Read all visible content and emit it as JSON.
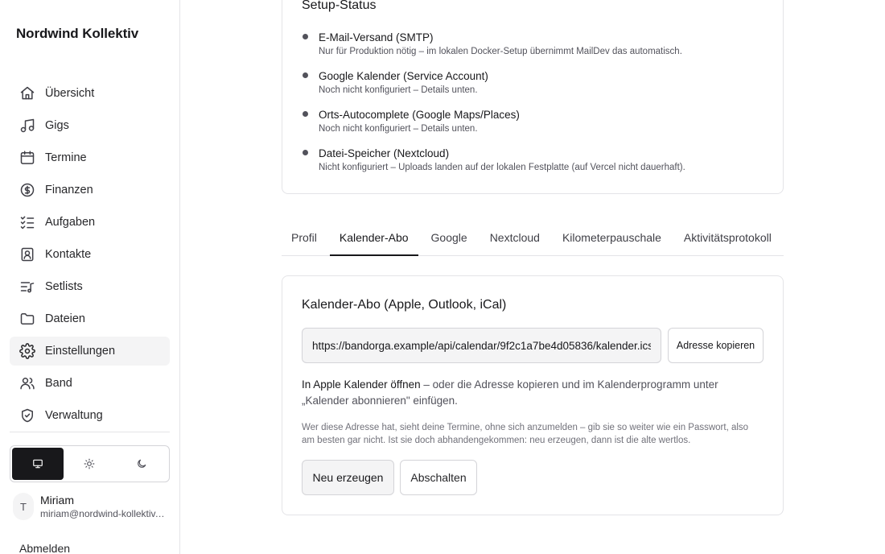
{
  "app": {
    "brand": "Nordwind Kollektiv"
  },
  "sidebar": {
    "items": [
      {
        "label": "Übersicht",
        "icon": "home-icon"
      },
      {
        "label": "Gigs",
        "icon": "music-note-icon"
      },
      {
        "label": "Termine",
        "icon": "calendar-icon"
      },
      {
        "label": "Finanzen",
        "icon": "dollar-circle-icon"
      },
      {
        "label": "Aufgaben",
        "icon": "list-checks-icon"
      },
      {
        "label": "Kontakte",
        "icon": "contact-book-icon"
      },
      {
        "label": "Setlists",
        "icon": "list-music-icon"
      },
      {
        "label": "Dateien",
        "icon": "folder-icon"
      },
      {
        "label": "Einstellungen",
        "icon": "gear-icon",
        "active": true
      },
      {
        "label": "Band",
        "icon": "users-icon"
      },
      {
        "label": "Verwaltung",
        "icon": "shield-check-icon"
      }
    ],
    "theme": {
      "options": [
        "system",
        "light",
        "dark"
      ],
      "selected": "system"
    },
    "user": {
      "initial": "T",
      "name": "Miriam",
      "email": "miriam@nordwind-kollektiv.de"
    },
    "logout_label": "Abmelden"
  },
  "setup_status": {
    "title": "Setup-Status",
    "items": [
      {
        "title": "E-Mail-Versand (SMTP)",
        "desc": "Nur für Produktion nötig – im lokalen Docker-Setup übernimmt MailDev das automatisch."
      },
      {
        "title": "Google Kalender (Service Account)",
        "desc": "Noch nicht konfiguriert – Details unten."
      },
      {
        "title": "Orts-Autocomplete (Google Maps/Places)",
        "desc": "Noch nicht konfiguriert – Details unten."
      },
      {
        "title": "Datei-Speicher (Nextcloud)",
        "desc": "Nicht konfiguriert – Uploads landen auf der lokalen Festplatte (auf Vercel nicht dauerhaft)."
      }
    ]
  },
  "tabs": [
    {
      "label": "Profil"
    },
    {
      "label": "Kalender-Abo",
      "active": true
    },
    {
      "label": "Google"
    },
    {
      "label": "Nextcloud"
    },
    {
      "label": "Kilometerpauschale"
    },
    {
      "label": "Aktivitätsprotokoll"
    }
  ],
  "calendar": {
    "title": "Kalender-Abo (Apple, Outlook, iCal)",
    "url": "https://bandorga.example/api/calendar/9f2c1a7be4d05836/kalender.ics",
    "copy_label": "Adresse kopieren",
    "apple_link": "In Apple Kalender öffnen",
    "text_rest": " – oder die Adresse kopieren und im Kalenderprogramm unter „Kalender abonnieren\" einfügen.",
    "note": "Wer diese Adresse hat, sieht deine Termine, ohne sich anzumelden – gib sie so weiter wie ein Passwort, also am besten gar nicht. Ist sie doch abhandengekommen: neu erzeugen, dann ist die alte wertlos.",
    "regen_label": "Neu erzeugen",
    "disable_label": "Abschalten"
  }
}
